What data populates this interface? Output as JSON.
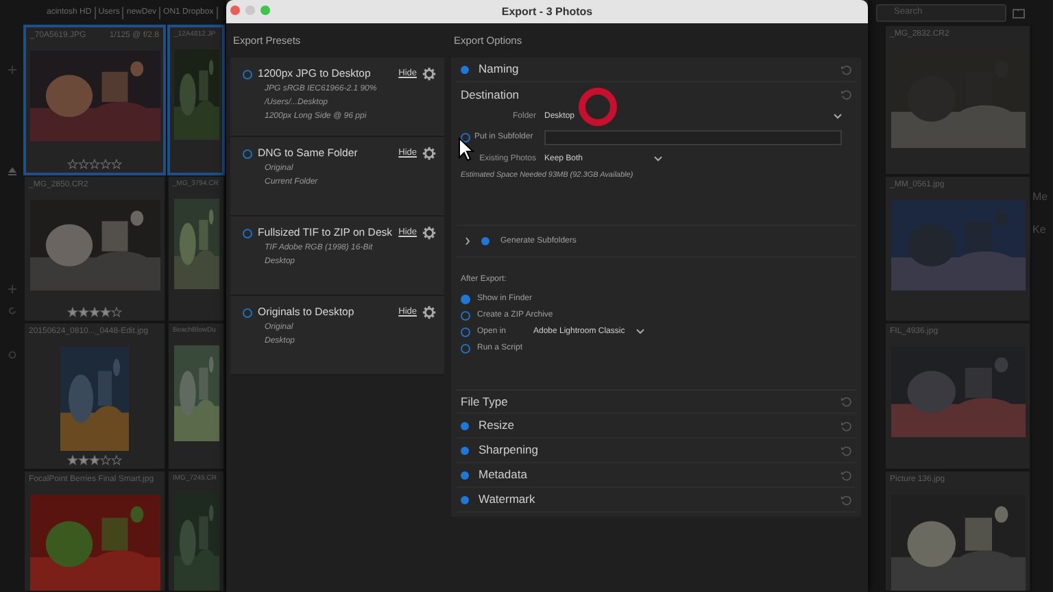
{
  "browser": {
    "path": [
      "acintosh HD",
      "Users",
      "newDev",
      "ON1 Dropbox"
    ],
    "search": {
      "placeholder": "Search"
    },
    "columns": [
      [
        {
          "name": "_70A5619.JPG",
          "info": "1/125 @ f/2.8",
          "selected": true,
          "stars": 0
        },
        {
          "name": "_MG_2850.CR2",
          "selected": false,
          "stars": 4
        },
        {
          "name": "20150624_0810..._0448-Edit.jpg",
          "selected": false,
          "stars": 3
        },
        {
          "name": "FocalPoint Berries Final Smart.jpg",
          "selected": false
        }
      ],
      [
        {
          "name": "_12A4812.JP",
          "selected": true
        },
        {
          "name": "_MG_3794.CR",
          "selected": false
        },
        {
          "name": "BeachBlowDu",
          "selected": false
        },
        {
          "name": "IMG_7245.CR",
          "selected": false
        }
      ],
      [
        {
          "name": "_MG_2832.CR2",
          "selected": false
        },
        {
          "name": "_MM_0561.jpg",
          "selected": false
        },
        {
          "name": "FIL_4936.jpg",
          "selected": false
        },
        {
          "name": "Picture 136.jpg",
          "selected": false
        }
      ]
    ],
    "side_panel": [
      "Me",
      "Ke"
    ]
  },
  "dialog": {
    "title": "Export - 3 Photos",
    "presets_heading": "Export Presets",
    "presets": [
      {
        "name": "1200px JPG to Desktop",
        "details": [
          "JPG  sRGB IEC61966-2.1  90%",
          "/Users/...Desktop",
          "1200px Long Side @ 96 ppi"
        ],
        "hide": "Hide"
      },
      {
        "name": "DNG to Same Folder",
        "details": [
          "Original",
          "Current Folder"
        ],
        "hide": "Hide"
      },
      {
        "name": "Fullsized TIF to ZIP on Desk",
        "details": [
          "TIF  Adobe RGB (1998)  16-Bit",
          "Desktop"
        ],
        "hide": "Hide"
      },
      {
        "name": "Originals to Desktop",
        "details": [
          "Original",
          "Desktop"
        ],
        "hide": "Hide"
      }
    ],
    "options_heading": "Export Options",
    "naming": {
      "label": "Naming",
      "enabled": true
    },
    "destination": {
      "label": "Destination",
      "enabled": false,
      "folder_label": "Folder",
      "folder": "Desktop",
      "subfolder_label": "Put in Subfolder",
      "subfolder_checked": false,
      "existing_label": "Existing Photos",
      "existing": "Keep Both",
      "estimate": "Estimated Space Needed 93MB (92.3GB Available)",
      "generate": {
        "label": "Generate Subfolders",
        "expanded": false,
        "enabled": true
      },
      "after_heading": "After Export:",
      "after_options": [
        {
          "label": "Show in Finder",
          "selected": true
        },
        {
          "label": "Create a ZIP Archive",
          "selected": false
        },
        {
          "label": "Open in",
          "selected": false,
          "app": "Adobe Lightroom Classic"
        },
        {
          "label": "Run a Script",
          "selected": false
        }
      ]
    },
    "sections": [
      {
        "label": "File Type",
        "enabled": false
      },
      {
        "label": "Resize",
        "enabled": true
      },
      {
        "label": "Sharpening",
        "enabled": true
      },
      {
        "label": "Metadata",
        "enabled": true
      },
      {
        "label": "Watermark",
        "enabled": true
      }
    ]
  }
}
